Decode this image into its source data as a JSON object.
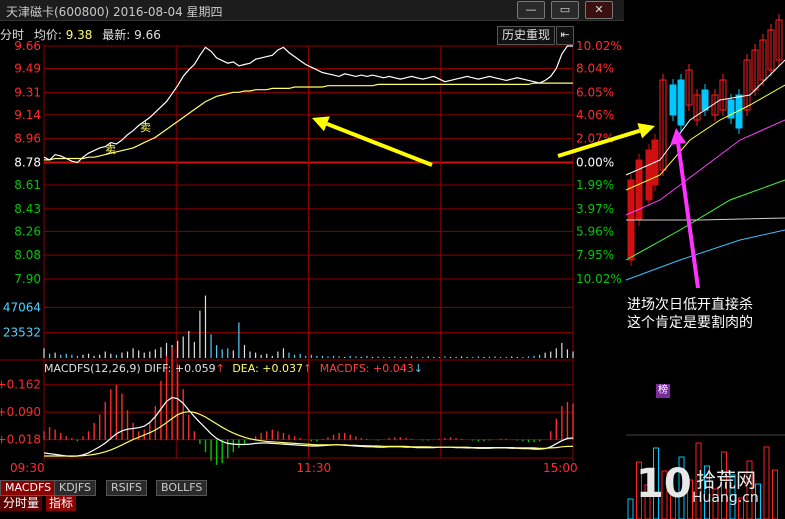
{
  "window": {
    "title": "天津磁卡(600800) 2016-08-04 星期四",
    "min_label": "—",
    "max_label": "▭",
    "close_label": "✕"
  },
  "infobar": {
    "label": "分时",
    "avg_label": "均价:",
    "avg_value": "9.38",
    "last_label": "最新:",
    "last_value": "9.66"
  },
  "buttons": {
    "history": "历史重现",
    "back": "⇤"
  },
  "colors": {
    "up": "#ff2a2a",
    "down": "#00c800",
    "grid": "#8b0000",
    "price_line": "#ffffff",
    "avg_line": "#ffff66",
    "arrow_yellow": "#ffff00",
    "arrow_magenta": "#ff33ff",
    "volume_axis_text": "#4fd1ff"
  },
  "macd_header": {
    "name": "MACDFS(12,26,9)",
    "diff": "DIFF: +0.059",
    "dea": "DEA: +0.037",
    "macdfs": "MACDFS: +0.043"
  },
  "tabs": [
    "MACDFS",
    "KDJFS",
    "RSIFS",
    "BOLLFS"
  ],
  "bottom_tabs": [
    "分时量",
    "指标"
  ],
  "badge_tags": [
    "卖",
    "卖"
  ],
  "annotation": {
    "line1": "进场次日低开直接杀",
    "line2": "这个肯定是要割肉的"
  },
  "right_panel_badge": "榜",
  "watermark": {
    "num": "10",
    "cn": "拾荒网",
    "domain": "Huang.cn"
  },
  "chart_data": {
    "type": "line",
    "title": "天津磁卡(600800) 2016-08-04 星期四",
    "price_ticks_left": [
      "9.66",
      "9.49",
      "9.31",
      "9.14",
      "8.96",
      "8.78",
      "8.61",
      "8.43",
      "8.26",
      "8.08",
      "7.90"
    ],
    "price_tick_values": [
      9.66,
      9.49,
      9.31,
      9.14,
      8.96,
      8.78,
      8.61,
      8.43,
      8.26,
      8.08,
      7.9
    ],
    "pct_ticks_right": [
      "10.02%",
      "8.04%",
      "6.05%",
      "4.06%",
      "2.07%",
      "0.00%",
      "1.99%",
      "3.97%",
      "5.96%",
      "7.95%",
      "10.02%"
    ],
    "prev_close": 8.78,
    "ylim": [
      7.9,
      9.66
    ],
    "x_ticks": [
      "09:30",
      "11:30",
      "15:00"
    ],
    "volume_ticks": [
      "47064",
      "23532"
    ],
    "volume_max": 70596,
    "macd_ticks": [
      "+0.162",
      "+0.090",
      "+0.018"
    ],
    "macd_tick_values": [
      0.162,
      0.09,
      0.018
    ],
    "series": [
      {
        "name": "最新",
        "values": [
          8.82,
          8.8,
          8.84,
          8.83,
          8.81,
          8.79,
          8.78,
          8.82,
          8.85,
          8.87,
          8.89,
          8.9,
          8.93,
          8.92,
          8.95,
          8.99,
          9.02,
          9.06,
          9.09,
          9.12,
          9.16,
          9.2,
          9.24,
          9.3,
          9.36,
          9.43,
          9.48,
          9.52,
          9.59,
          9.65,
          9.62,
          9.57,
          9.55,
          9.53,
          9.54,
          9.51,
          9.52,
          9.53,
          9.56,
          9.57,
          9.58,
          9.59,
          9.63,
          9.65,
          9.61,
          9.58,
          9.55,
          9.52,
          9.5,
          9.48,
          9.46,
          9.45,
          9.44,
          9.43,
          9.45,
          9.44,
          9.43,
          9.44,
          9.43,
          9.44,
          9.43,
          9.42,
          9.43,
          9.42,
          9.41,
          9.42,
          9.43,
          9.42,
          9.41,
          9.42,
          9.43,
          9.41,
          9.39,
          9.4,
          9.41,
          9.42,
          9.43,
          9.42,
          9.41,
          9.42,
          9.43,
          9.42,
          9.41,
          9.4,
          9.41,
          9.42,
          9.41,
          9.4,
          9.39,
          9.38,
          9.4,
          9.43,
          9.49,
          9.6,
          9.66,
          9.66
        ]
      },
      {
        "name": "均价",
        "values": [
          8.8,
          8.8,
          8.81,
          8.81,
          8.81,
          8.81,
          8.81,
          8.81,
          8.82,
          8.82,
          8.83,
          8.84,
          8.85,
          8.86,
          8.87,
          8.88,
          8.89,
          8.91,
          8.93,
          8.95,
          8.97,
          9.0,
          9.03,
          9.06,
          9.09,
          9.12,
          9.15,
          9.18,
          9.21,
          9.24,
          9.26,
          9.28,
          9.29,
          9.3,
          9.31,
          9.31,
          9.32,
          9.32,
          9.33,
          9.33,
          9.33,
          9.34,
          9.34,
          9.34,
          9.34,
          9.35,
          9.35,
          9.35,
          9.35,
          9.35,
          9.35,
          9.36,
          9.36,
          9.36,
          9.36,
          9.36,
          9.36,
          9.36,
          9.36,
          9.36,
          9.37,
          9.37,
          9.37,
          9.37,
          9.37,
          9.37,
          9.37,
          9.37,
          9.37,
          9.37,
          9.37,
          9.37,
          9.37,
          9.37,
          9.37,
          9.37,
          9.37,
          9.37,
          9.37,
          9.37,
          9.37,
          9.37,
          9.37,
          9.37,
          9.37,
          9.37,
          9.37,
          9.37,
          9.38,
          9.38,
          9.38,
          9.38,
          9.38,
          9.38,
          9.38,
          9.38
        ]
      }
    ],
    "volume": [
      9000,
      4000,
      5000,
      3000,
      4000,
      3000,
      2000,
      3000,
      4000,
      2000,
      3000,
      6000,
      4000,
      3000,
      5000,
      6000,
      9000,
      7000,
      5000,
      6000,
      8000,
      10000,
      14000,
      12000,
      16000,
      20000,
      25000,
      15000,
      44000,
      58000,
      22000,
      12000,
      8000,
      9000,
      7000,
      33000,
      12000,
      6000,
      5000,
      3000,
      4000,
      2000,
      6000,
      9000,
      5000,
      3000,
      4000,
      2000,
      3000,
      2000,
      2000,
      1500,
      2000,
      1500,
      1000,
      2000,
      1500,
      1000,
      2000,
      1000,
      1500,
      1000,
      1000,
      1500,
      1000,
      1000,
      1500,
      1000,
      1000,
      1500,
      1000,
      1000,
      1500,
      1000,
      1000,
      1500,
      1000,
      1000,
      1500,
      1000,
      1000,
      1500,
      1000,
      1000,
      1500,
      1000,
      1000,
      1500,
      2000,
      3000,
      5000,
      6000,
      9000,
      14000,
      8000,
      6000
    ],
    "macd_bars": [
      0.01,
      0.015,
      0.012,
      0.008,
      0.004,
      0.002,
      -0.002,
      0.004,
      0.01,
      0.02,
      0.03,
      0.045,
      0.06,
      0.065,
      0.055,
      0.035,
      0.02,
      0.01,
      0.012,
      0.02,
      0.04,
      0.07,
      0.1,
      0.11,
      0.09,
      0.06,
      0.03,
      0.01,
      -0.005,
      -0.015,
      -0.025,
      -0.03,
      -0.028,
      -0.022,
      -0.015,
      -0.01,
      -0.006,
      0.0,
      0.004,
      0.008,
      0.01,
      0.012,
      0.01,
      0.008,
      0.006,
      0.004,
      0.002,
      0.0,
      -0.002,
      -0.002,
      0.001,
      0.003,
      0.006,
      0.008,
      0.008,
      0.006,
      0.004,
      0.002,
      0.001,
      0.0,
      -0.001,
      0.0,
      0.002,
      0.003,
      0.003,
      0.002,
      0.001,
      0.0,
      -0.001,
      -0.001,
      0.0,
      0.001,
      0.002,
      0.003,
      0.002,
      0.001,
      0.0,
      -0.001,
      -0.002,
      -0.002,
      -0.001,
      0.0,
      0.001,
      0.001,
      0.0,
      -0.001,
      -0.002,
      -0.003,
      -0.003,
      -0.002,
      0.0,
      0.01,
      0.025,
      0.04,
      0.045,
      0.043
    ],
    "diff_line": [
      0.02,
      0.018,
      0.016,
      0.014,
      0.012,
      0.011,
      0.012,
      0.015,
      0.02,
      0.028,
      0.036,
      0.046,
      0.058,
      0.07,
      0.078,
      0.082,
      0.084,
      0.086,
      0.09,
      0.1,
      0.115,
      0.135,
      0.155,
      0.165,
      0.162,
      0.15,
      0.132,
      0.115,
      0.1,
      0.085,
      0.07,
      0.058,
      0.05,
      0.045,
      0.043,
      0.042,
      0.042,
      0.043,
      0.045,
      0.046,
      0.046,
      0.045,
      0.044,
      0.043,
      0.042,
      0.041,
      0.04,
      0.039,
      0.038,
      0.038,
      0.039,
      0.04,
      0.041,
      0.041,
      0.04,
      0.039,
      0.038,
      0.037,
      0.036,
      0.036,
      0.035,
      0.035,
      0.036,
      0.036,
      0.036,
      0.035,
      0.035,
      0.034,
      0.034,
      0.034,
      0.034,
      0.035,
      0.035,
      0.035,
      0.034,
      0.034,
      0.033,
      0.033,
      0.032,
      0.032,
      0.032,
      0.033,
      0.033,
      0.033,
      0.032,
      0.032,
      0.031,
      0.031,
      0.03,
      0.03,
      0.031,
      0.036,
      0.044,
      0.052,
      0.058,
      0.059
    ],
    "dea_line": [
      0.012,
      0.012,
      0.012,
      0.012,
      0.012,
      0.012,
      0.012,
      0.013,
      0.014,
      0.016,
      0.019,
      0.023,
      0.028,
      0.034,
      0.041,
      0.048,
      0.055,
      0.061,
      0.067,
      0.073,
      0.08,
      0.089,
      0.099,
      0.11,
      0.12,
      0.126,
      0.128,
      0.126,
      0.121,
      0.114,
      0.105,
      0.096,
      0.087,
      0.079,
      0.072,
      0.066,
      0.061,
      0.057,
      0.054,
      0.052,
      0.05,
      0.049,
      0.048,
      0.047,
      0.046,
      0.045,
      0.044,
      0.043,
      0.042,
      0.041,
      0.041,
      0.041,
      0.041,
      0.041,
      0.041,
      0.04,
      0.04,
      0.039,
      0.039,
      0.038,
      0.038,
      0.037,
      0.037,
      0.037,
      0.037,
      0.037,
      0.036,
      0.036,
      0.036,
      0.036,
      0.035,
      0.035,
      0.035,
      0.035,
      0.035,
      0.035,
      0.035,
      0.034,
      0.034,
      0.034,
      0.034,
      0.034,
      0.034,
      0.034,
      0.034,
      0.033,
      0.033,
      0.033,
      0.033,
      0.032,
      0.032,
      0.033,
      0.034,
      0.036,
      0.037,
      0.037
    ]
  }
}
